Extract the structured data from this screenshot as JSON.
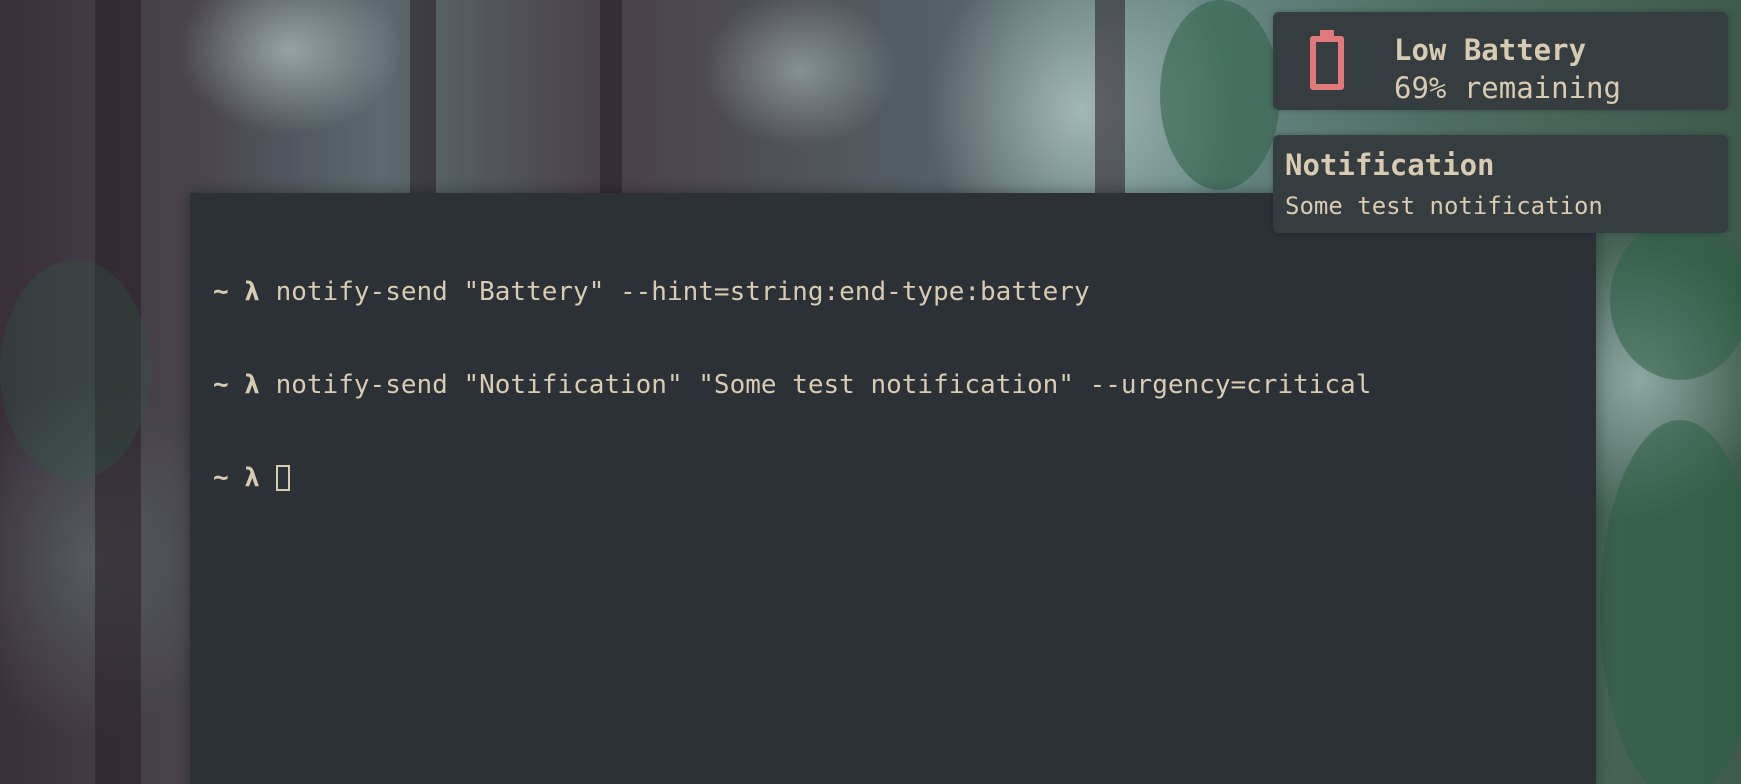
{
  "terminal": {
    "lines": [
      {
        "prompt": "~ λ",
        "command": "notify-send \"Battery\" --hint=string:end-type:battery"
      },
      {
        "prompt": "~ λ",
        "command": "notify-send \"Notification\" \"Some test notification\" --urgency=critical"
      },
      {
        "prompt": "~ λ",
        "command": ""
      }
    ],
    "colors": {
      "background": "#2b3137",
      "foreground": "#d8cbb0"
    }
  },
  "notifications": {
    "battery": {
      "icon": "battery-icon",
      "icon_color": "#e07a7a",
      "title": "Low Battery",
      "body": "69% remaining",
      "level": 0.69
    },
    "generic": {
      "title": "Notification",
      "body": "Some test notification"
    },
    "colors": {
      "background": "#363d40",
      "text": "#d8cbb0"
    }
  }
}
